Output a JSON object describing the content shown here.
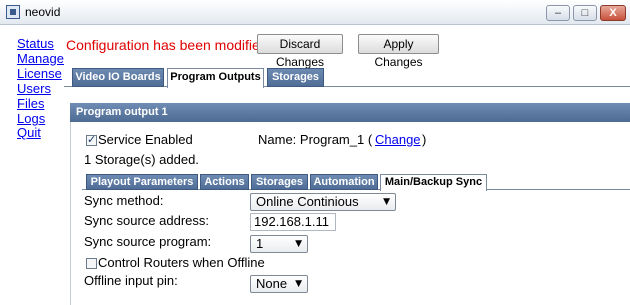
{
  "window": {
    "title": "neovid",
    "min_label": "–",
    "max_label": "□",
    "close_label": "X"
  },
  "nav": [
    "Status",
    "Manage",
    "License",
    "Users",
    "Files",
    "Logs",
    "Quit"
  ],
  "banner": {
    "message": "Configuration has been modified",
    "discard_label": "Discard Changes",
    "apply_label": "Apply Changes"
  },
  "tabs": [
    "Video IO Boards",
    "Program Outputs",
    "Storages"
  ],
  "panel": {
    "title": "Program output 1",
    "service_enabled_label": "Service Enabled",
    "name_label": "Name: Program_1 (",
    "change_link": "Change",
    "name_suffix": ")",
    "storage_info": "1 Storage(s) added."
  },
  "subtabs": [
    "Playout Parameters",
    "Actions",
    "Storages",
    "Automation",
    "Main/Backup Sync"
  ],
  "sync": {
    "method_label": "Sync method:",
    "method_value": "Online Continious",
    "address_label": "Sync source address:",
    "address_value": "192.168.1.11",
    "program_label": "Sync source program:",
    "program_value": "1",
    "control_routers_label": "Control Routers when Offline",
    "offline_pin_label": "Offline input pin:",
    "offline_pin_value": "None"
  }
}
